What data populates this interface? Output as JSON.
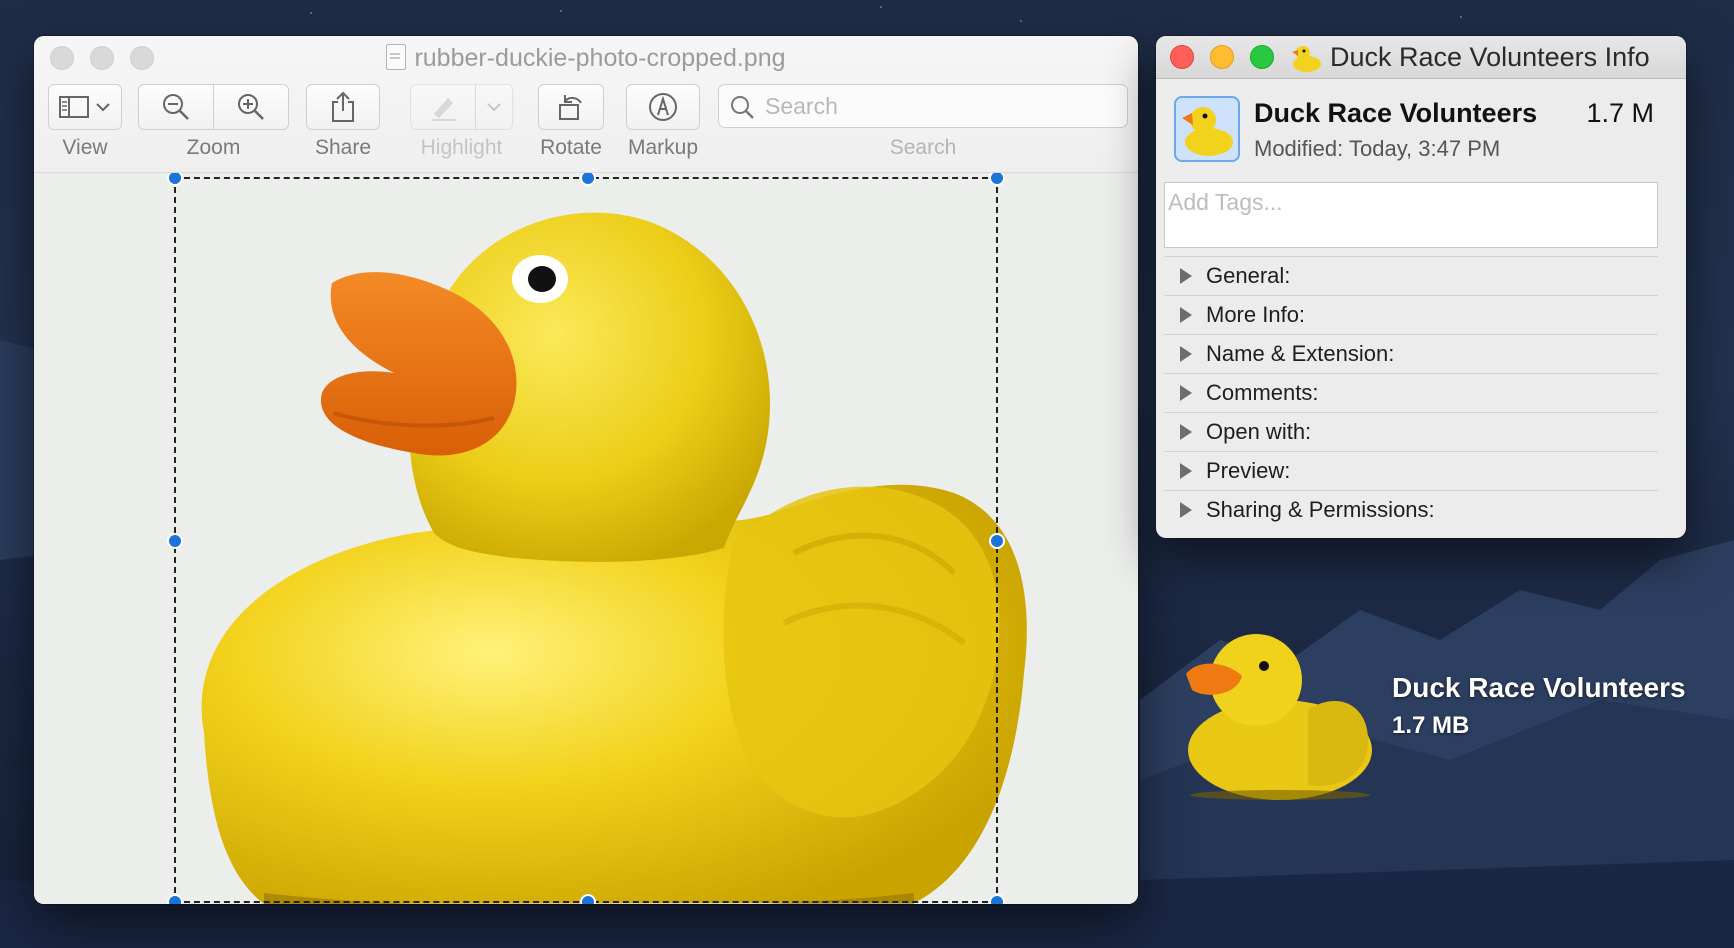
{
  "preview": {
    "title": "rubber-duckie-photo-cropped.png",
    "toolbar": {
      "view_label": "View",
      "zoom_label": "Zoom",
      "share_label": "Share",
      "highlight_label": "Highlight",
      "rotate_label": "Rotate",
      "markup_label": "Markup",
      "search_label": "Search",
      "search_placeholder": "Search"
    }
  },
  "info": {
    "window_title": "Duck Race Volunteers Info",
    "name": "Duck Race Volunteers",
    "size": "1.7 M",
    "modified": "Modified:  Today, 3:47 PM",
    "tags_placeholder": "Add Tags...",
    "sections": [
      "General:",
      "More Info:",
      "Name & Extension:",
      "Comments:",
      "Open with:",
      "Preview:",
      "Sharing & Permissions:"
    ]
  },
  "desktop_icon": {
    "name": "Duck Race Volunteers",
    "size": "1.7 MB"
  },
  "icons": [
    "document-icon",
    "sidebar-icon",
    "chevron-down-icon",
    "zoom-out-icon",
    "zoom-in-icon",
    "share-icon",
    "highlight-pen-icon",
    "rotate-icon",
    "markup-icon",
    "search-icon",
    "disclosure-triangle-icon",
    "duck-icon"
  ],
  "colors": {
    "close": "#fe5f57",
    "minimize": "#febc2e",
    "maximize": "#28c840",
    "selection_handle": "#1b74d8",
    "duck_yellow": "#f2d21c",
    "beak_orange": "#f07a12"
  }
}
